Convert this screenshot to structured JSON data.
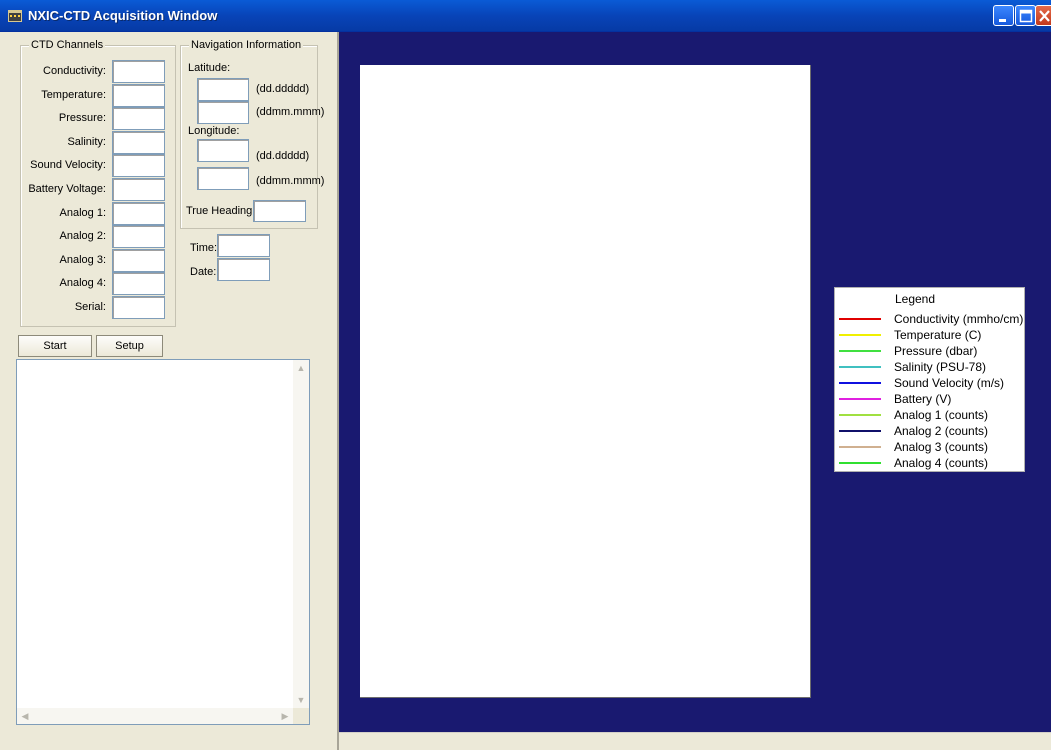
{
  "window": {
    "title": "NXIC-CTD Acquisition Window",
    "icon": "app-icon",
    "controls": [
      "minimize-icon",
      "maximize-icon",
      "close-icon"
    ]
  },
  "ctd_channels": {
    "title": "CTD Channels",
    "fields": [
      {
        "label": "Conductivity:",
        "value": ""
      },
      {
        "label": "Temperature:",
        "value": ""
      },
      {
        "label": "Pressure:",
        "value": ""
      },
      {
        "label": "Salinity:",
        "value": ""
      },
      {
        "label": "Sound Velocity:",
        "value": ""
      },
      {
        "label": "Battery Voltage:",
        "value": ""
      },
      {
        "label": "Analog 1:",
        "value": ""
      },
      {
        "label": "Analog 2:",
        "value": ""
      },
      {
        "label": "Analog 3:",
        "value": ""
      },
      {
        "label": "Analog 4:",
        "value": ""
      },
      {
        "label": "Serial:",
        "value": ""
      }
    ]
  },
  "navigation": {
    "title": "Navigation Information",
    "latitude_label": "Latitude:",
    "longitude_label": "Longitude:",
    "decimal_unit": "(dd.ddddd)",
    "dm_unit": "(ddmm.mmm)",
    "true_heading_label": "True Heading:",
    "latitude_decimal": "",
    "latitude_dm": "",
    "longitude_decimal": "",
    "longitude_dm": "",
    "true_heading": ""
  },
  "time_date": {
    "time_label": "Time:",
    "date_label": "Date:",
    "time": "",
    "date": ""
  },
  "buttons": {
    "start": "Start",
    "setup": "Setup"
  },
  "log_text": "",
  "plot": {
    "background_color": "#191970",
    "canvas_color": "#ffffff"
  },
  "legend": {
    "title": "Legend",
    "items": [
      {
        "label": "Conductivity (mmho/cm)",
        "color": "#e00000"
      },
      {
        "label": "Temperature (C)",
        "color": "#f0f000"
      },
      {
        "label": "Pressure (dbar)",
        "color": "#40e040"
      },
      {
        "label": "Salinity (PSU-78)",
        "color": "#40c0c0"
      },
      {
        "label": "Sound Velocity (m/s)",
        "color": "#1010e0"
      },
      {
        "label": "Battery (V)",
        "color": "#e020e0"
      },
      {
        "label": "Analog 1 (counts)",
        "color": "#a0e040"
      },
      {
        "label": "Analog 2 (counts)",
        "color": "#10106a"
      },
      {
        "label": "Analog 3 (counts)",
        "color": "#d0b090"
      },
      {
        "label": "Analog 4 (counts)",
        "color": "#30e030"
      }
    ]
  }
}
